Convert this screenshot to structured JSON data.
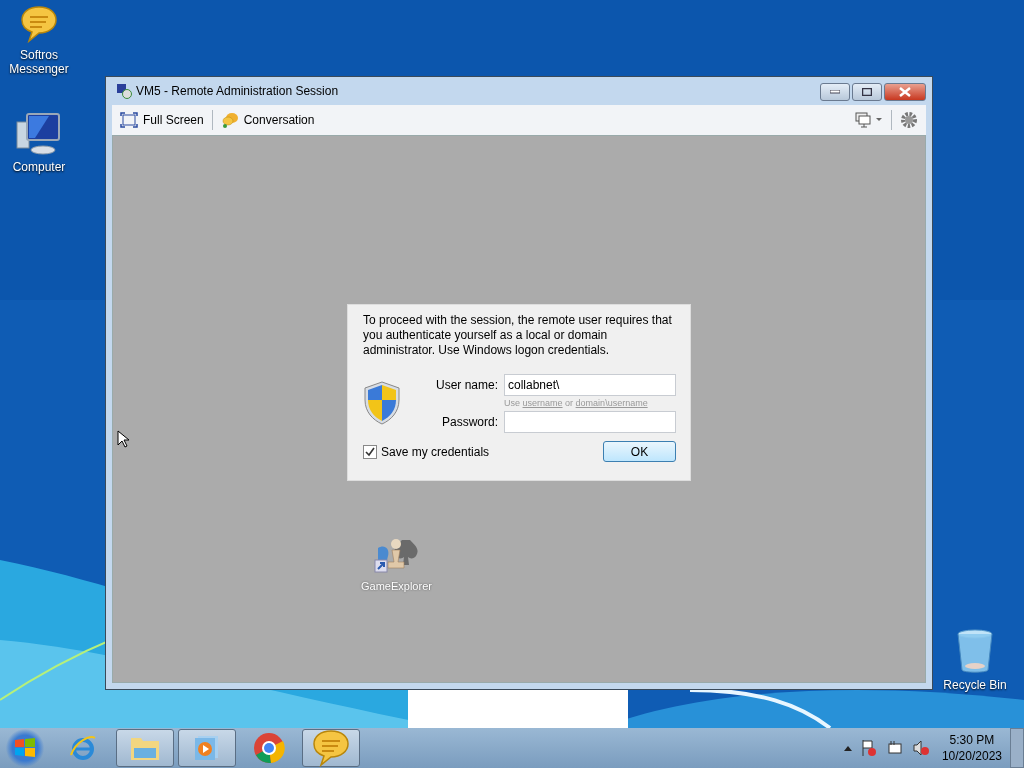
{
  "desktop_icons": [
    {
      "kind": "messenger",
      "label": "Softros\nMessenger"
    },
    {
      "kind": "computer",
      "label": "Computer"
    },
    {
      "kind": "recycle",
      "label": "Recycle Bin"
    }
  ],
  "window": {
    "title": "VM5 - Remote Administration Session",
    "toolbar": [
      {
        "kind": "fullscreen",
        "label": "Full Screen"
      },
      {
        "kind": "conversation",
        "label": "Conversation"
      }
    ],
    "remote_desktop": {
      "icon_label": "GameExplorer"
    },
    "dialog": {
      "message": "To proceed with the session, the remote user requires that you authenticate yourself as a local or domain administrator. Use Windows logon credentials.",
      "username_label": "User name:",
      "username_value": "collabnet\\",
      "hint_prefix": "Use",
      "hint_link_1": "username",
      "hint_middle": "or",
      "hint_link_2": "domain\\username",
      "password_label": "Password:",
      "save_credentials": {
        "label": "Save my credentials",
        "checked": true
      },
      "ok_button": "OK"
    }
  },
  "taskbar": {
    "items": [
      {
        "kind": "ie",
        "running": false
      },
      {
        "kind": "explorer",
        "running": true
      },
      {
        "kind": "media",
        "running": true
      },
      {
        "kind": "chrome",
        "running": false
      },
      {
        "kind": "messenger",
        "running": true
      }
    ],
    "time": "5:30 PM",
    "date": "10/20/2023"
  }
}
